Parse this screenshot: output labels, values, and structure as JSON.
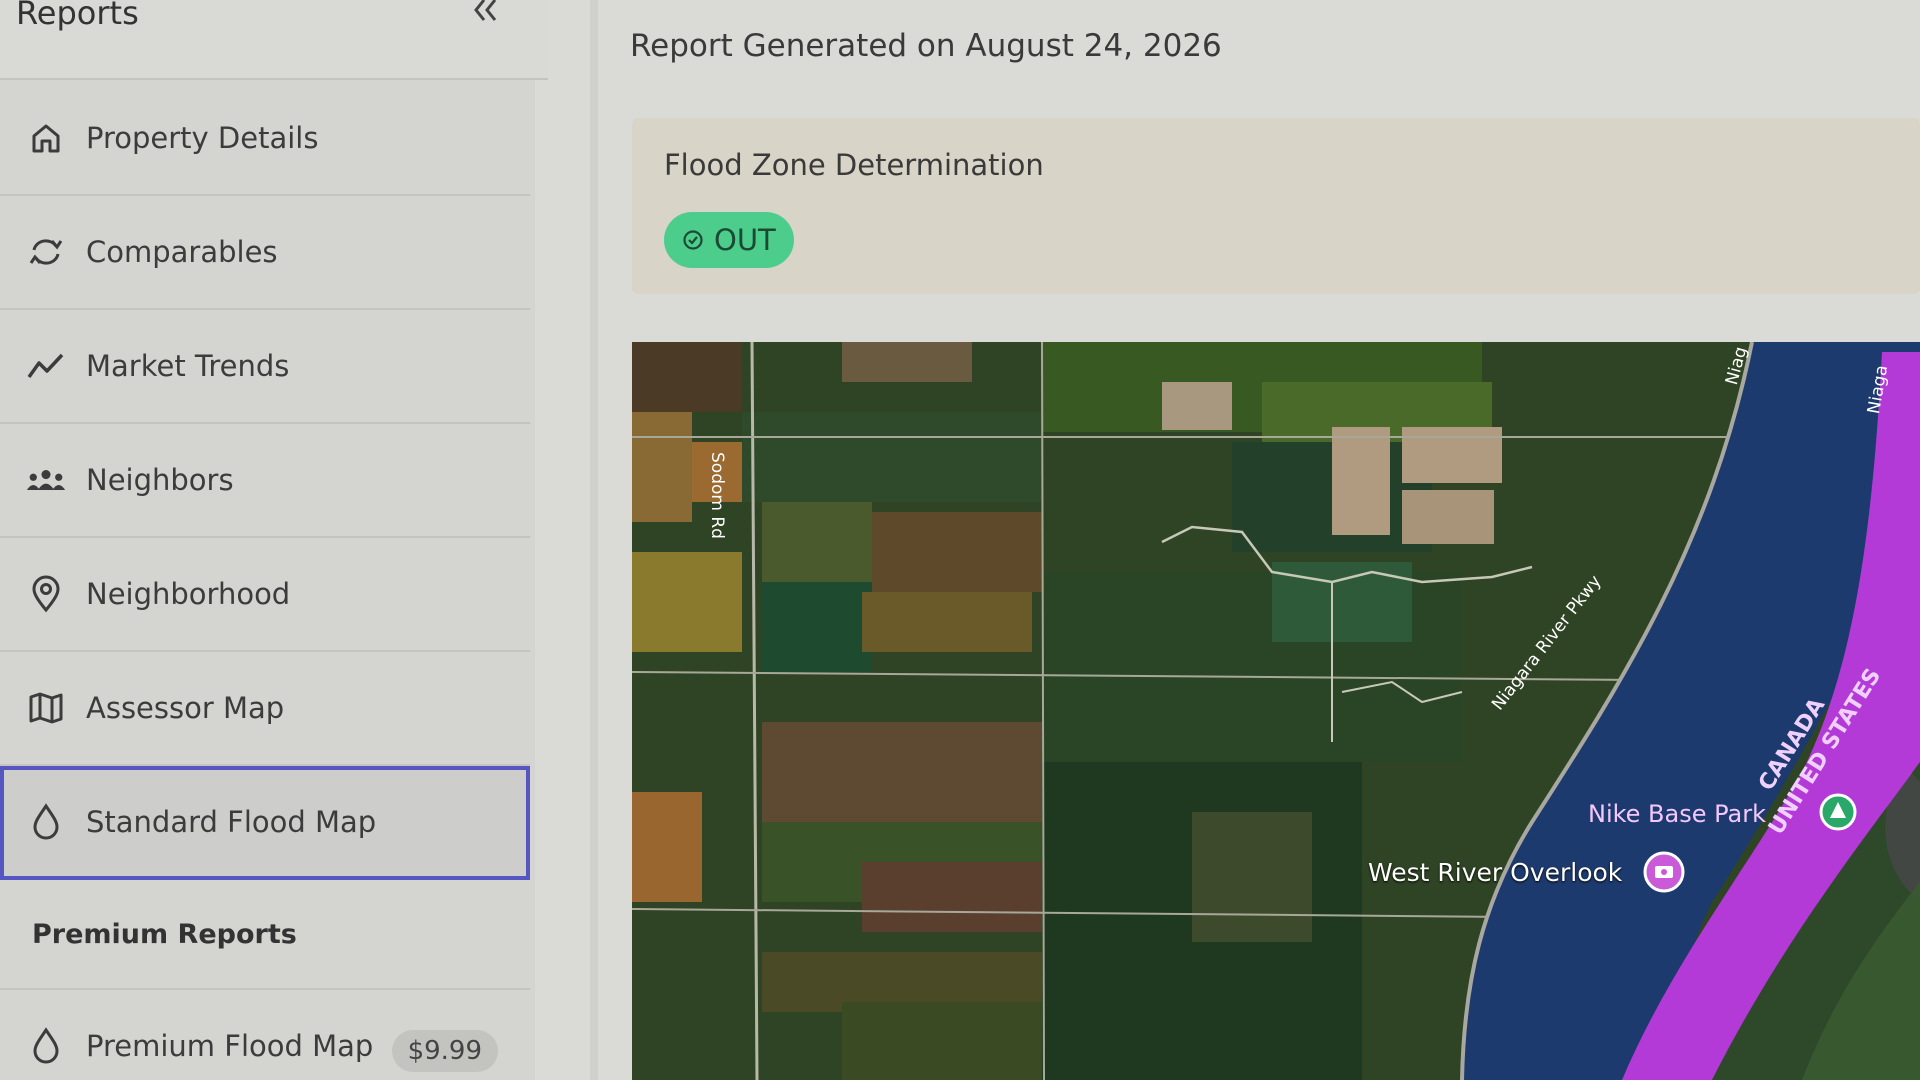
{
  "sidebar": {
    "title": "Reports",
    "collapse_icon": "double-chevron-left-icon",
    "items": [
      {
        "label": "Property Details",
        "icon": "home-icon",
        "active": false
      },
      {
        "label": "Comparables",
        "icon": "refresh-icon",
        "active": false
      },
      {
        "label": "Market Trends",
        "icon": "trend-line-icon",
        "active": false
      },
      {
        "label": "Neighbors",
        "icon": "people-icon",
        "active": false
      },
      {
        "label": "Neighborhood",
        "icon": "map-pin-icon",
        "active": false
      },
      {
        "label": "Assessor Map",
        "icon": "folded-map-icon",
        "active": false
      },
      {
        "label": "Standard Flood Map",
        "icon": "water-drop-icon",
        "active": true
      }
    ],
    "premium_section": {
      "label": "Premium Reports",
      "items": [
        {
          "label": "Premium Flood Map",
          "icon": "water-drop-icon",
          "price": "$9.99"
        }
      ]
    }
  },
  "main": {
    "report_date": "Report Generated on August 24, 2026",
    "flood_zone": {
      "title": "Flood Zone Determination",
      "status": "OUT",
      "status_icon": "check-circle-icon",
      "status_color": "#4ccd8c"
    },
    "map": {
      "type": "satellite",
      "labels": {
        "road_sodom": "Sodom Rd",
        "road_parkway": "Niagara River Pkwy",
        "road_niagara_top": "Niag",
        "road_niagara_right": "Niaga",
        "border_canada": "CANADA",
        "border_us": "UNITED STATES",
        "poi_park": "Nike Base Park",
        "poi_overlook": "West River Overlook"
      },
      "poi_icons": {
        "park": "tree-icon",
        "overlook": "camera-icon"
      },
      "colors": {
        "river": "#1d3a6e",
        "flood_zone": "#b43ad8",
        "vegetation": "#3e5a2c"
      }
    }
  }
}
